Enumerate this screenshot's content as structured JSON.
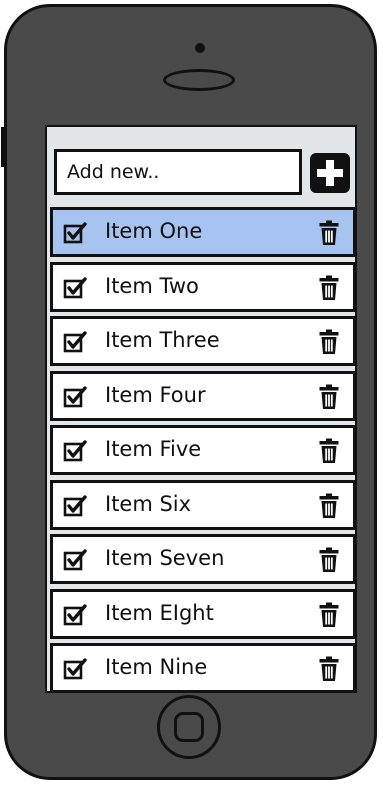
{
  "add_form": {
    "placeholder": "Add new..",
    "value": ""
  },
  "add_button": {
    "icon": "plus-icon"
  },
  "items": [
    {
      "label": "Item One",
      "checked": true,
      "selected": true
    },
    {
      "label": "Item Two",
      "checked": true,
      "selected": false
    },
    {
      "label": "Item Three",
      "checked": true,
      "selected": false
    },
    {
      "label": "Item Four",
      "checked": true,
      "selected": false
    },
    {
      "label": "Item Five",
      "checked": true,
      "selected": false
    },
    {
      "label": "Item Six",
      "checked": true,
      "selected": false
    },
    {
      "label": "Item Seven",
      "checked": true,
      "selected": false
    },
    {
      "label": "Item EIght",
      "checked": true,
      "selected": false
    },
    {
      "label": "Item Nine",
      "checked": true,
      "selected": false
    }
  ],
  "icons": {
    "check": "checkbox-checked-icon",
    "delete": "trash-icon"
  },
  "colors": {
    "selected_row": "#a7c4f1",
    "phone_body": "#4a4a4a",
    "screen_bg": "#e3e6e8"
  }
}
